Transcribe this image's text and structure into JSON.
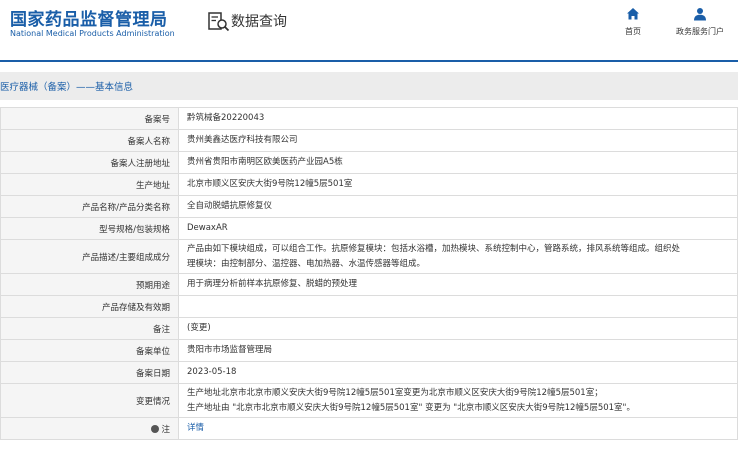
{
  "header": {
    "logo_cn": "国家药品监督管理局",
    "logo_en": "National Medical Products Administration",
    "section": "数据查询",
    "nav": [
      {
        "label": "首页",
        "icon": "home-icon"
      },
      {
        "label": "政务服务门户",
        "icon": "user-icon"
      }
    ]
  },
  "section_title": "医疗器械（备案）——基本信息",
  "rows": [
    {
      "label": "备案号",
      "value": "黔筑械备20220043"
    },
    {
      "label": "备案人名称",
      "value": "贵州美鑫达医疗科技有限公司"
    },
    {
      "label": "备案人注册地址",
      "value": "贵州省贵阳市南明区欧美医药产业园A5栋"
    },
    {
      "label": "生产地址",
      "value": "北京市顺义区安庆大街9号院12幢5层501室"
    },
    {
      "label": "产品名称/产品分类名称",
      "value": "全自动脱蜡抗原修复仪"
    },
    {
      "label": "型号规格/包装规格",
      "value": "DewaxAR"
    },
    {
      "label": "产品描述/主要组成成分",
      "value_lines": [
        "产品由如下模块组成，可以组合工作。抗原修复模块：包括水浴槽，加热模块、系统控制中心，管路系统，排风系统等组成。组织处",
        "理模块：由控制部分、温控器、电加热器、水温传感器等组成。"
      ]
    },
    {
      "label": "预期用途",
      "value": "用于病理分析前样本抗原修复、脱蜡的预处理"
    },
    {
      "label": "产品存储及有效期",
      "value": ""
    },
    {
      "label": "备注",
      "value": "(变更)"
    },
    {
      "label": "备案单位",
      "value": "贵阳市市场监督管理局"
    },
    {
      "label": "备案日期",
      "value": "2023-05-18"
    },
    {
      "label": "变更情况",
      "value_lines": [
        "生产地址北京市北京市顺义安庆大街9号院12幢5层501室变更为北京市顺义区安庆大街9号院12幢5层501室；",
        "生产地址由 \"北京市北京市顺义安庆大街9号院12幢5层501室\" 变更为 \"北京市顺义区安庆大街9号院12幢5层501室\"。"
      ]
    },
    {
      "label": "注",
      "value": "详情",
      "icon": "note-icon"
    }
  ],
  "colors": {
    "brand": "#1a5ea8",
    "label_bg": "#f5f5f5",
    "section_bg": "#ececec"
  }
}
